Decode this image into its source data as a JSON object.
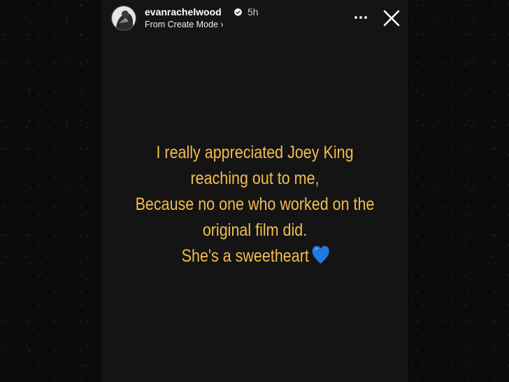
{
  "story": {
    "username": "evanrachelwood",
    "time": "5h",
    "source_label": "From Create Mode",
    "source_chevron": "›",
    "more_glyph": "•••",
    "caption_lines": [
      "I really appreciated Joey King",
      "reaching out to me,",
      "Because no one who worked on the",
      "original film did.",
      "She's a sweetheart"
    ]
  },
  "colors": {
    "caption_text": "#f2bd4f",
    "story_bg": "#141414",
    "verified_badge": "#3897f0",
    "heart": "#1f7be0"
  },
  "icons": {
    "avatar": "profile-photo",
    "verified": "verified-badge-icon",
    "more": "more-options-icon",
    "close": "close-icon",
    "heart": "blue-heart-icon"
  }
}
